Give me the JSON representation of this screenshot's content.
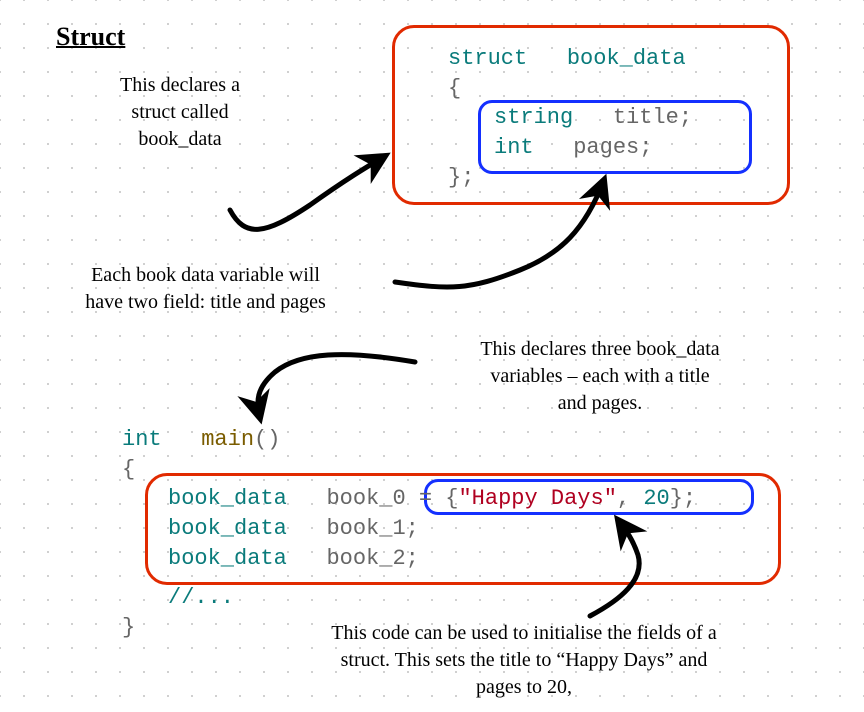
{
  "title": "Struct",
  "codeTop": {
    "l1a": "struct",
    "l1b": "book_data",
    "l2": "{",
    "l3a": "string",
    "l3b": "title;",
    "l4a": "int",
    "l4b": "pages;",
    "l5": "};"
  },
  "codeMain": {
    "h1a": "int",
    "h1b": "main",
    "h1c": "()",
    "h2": "{",
    "l1a": "book_data",
    "l1b": "book_0 = {",
    "l1c": "\"Happy Days\"",
    "l1d": ", ",
    "l1e": "20",
    "l1f": "};",
    "l2a": "book_data",
    "l2b": "book_1;",
    "l3a": "book_data",
    "l3b": "book_2;",
    "c1": "//...",
    "f1": "}"
  },
  "annos": {
    "a1l1": "This declares a",
    "a1l2": "struct called",
    "a1l3": "book_data",
    "a2l1": "Each book data variable will",
    "a2l2": "have two field: title and pages",
    "a3l1": "This declares three book_data",
    "a3l2": "variables – each with a title",
    "a3l3": "and pages.",
    "a4l1": "This code can be used to initialise the fields of a",
    "a4l2": "struct. This sets the title to “Happy Days” and",
    "a4l3": "pages to 20,"
  }
}
